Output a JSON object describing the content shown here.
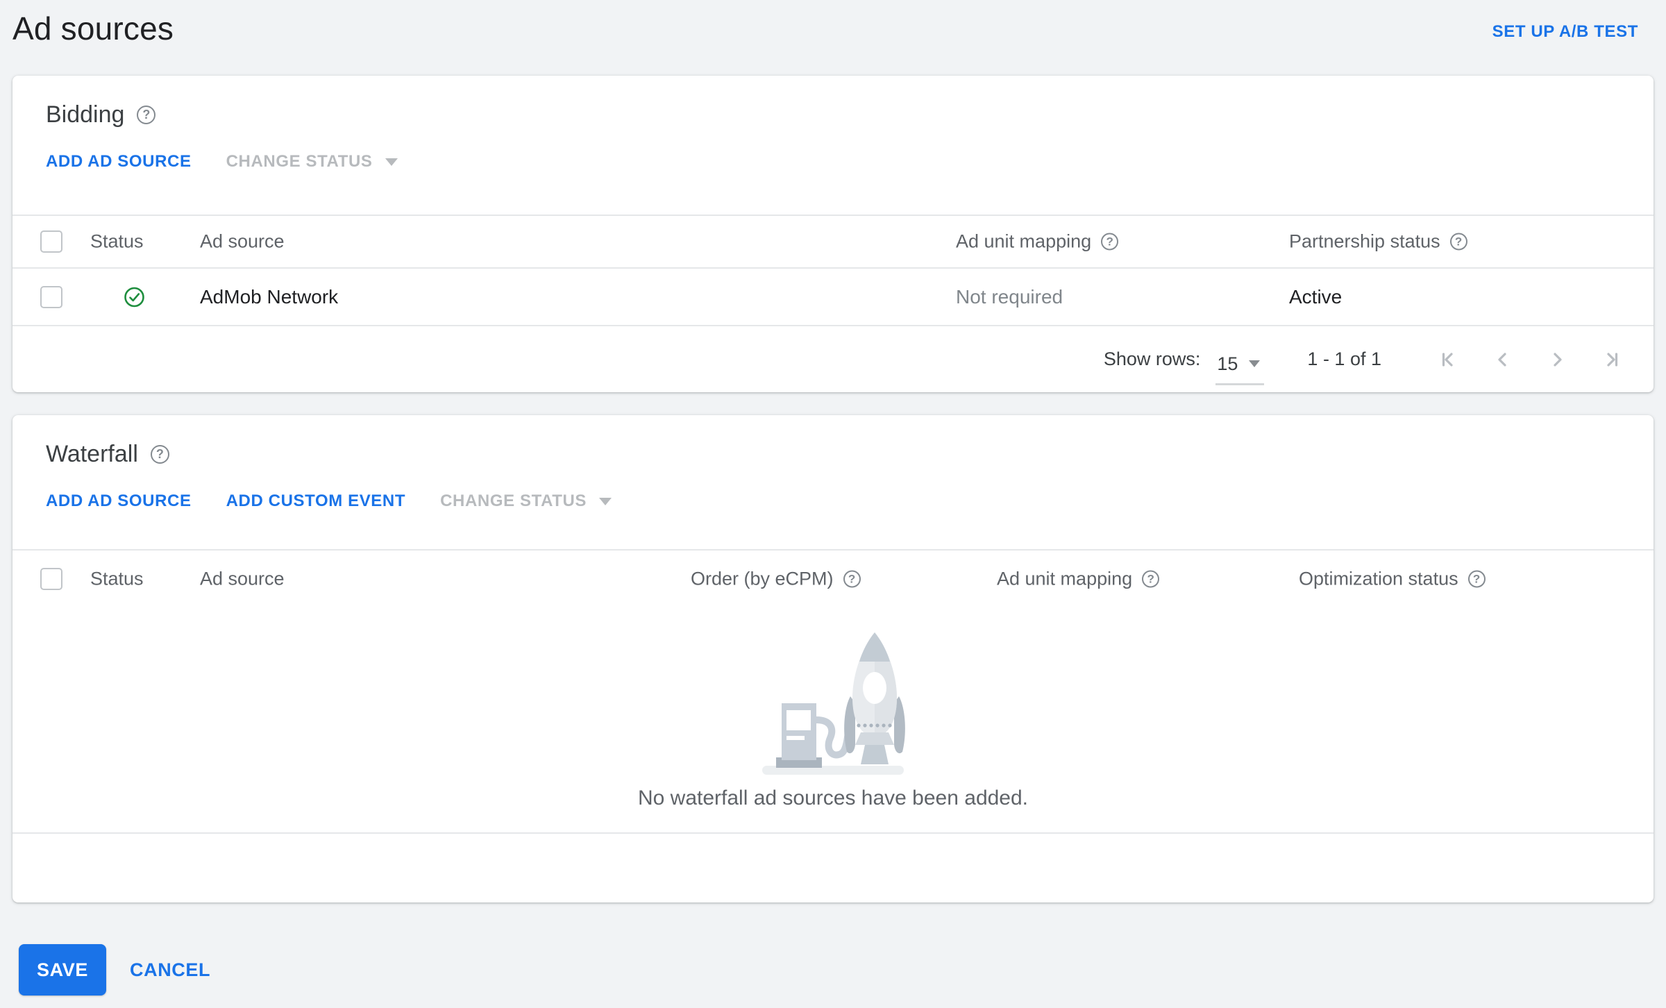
{
  "page": {
    "title": "Ad sources",
    "setup_ab_test": "SET UP A/B TEST"
  },
  "bidding": {
    "title": "Bidding",
    "actions": {
      "add_ad_source": "ADD AD SOURCE",
      "change_status": "CHANGE STATUS"
    },
    "table": {
      "headers": {
        "status": "Status",
        "ad_source": "Ad source",
        "ad_unit_mapping": "Ad unit mapping",
        "partnership_status": "Partnership status"
      },
      "rows": [
        {
          "status": "active",
          "ad_source": "AdMob Network",
          "ad_unit_mapping": "Not required",
          "partnership_status": "Active"
        }
      ]
    },
    "pagination": {
      "show_rows_label": "Show rows:",
      "show_rows_value": "15",
      "range": "1 - 1 of 1"
    }
  },
  "waterfall": {
    "title": "Waterfall",
    "actions": {
      "add_ad_source": "ADD AD SOURCE",
      "add_custom_event": "ADD CUSTOM EVENT",
      "change_status": "CHANGE STATUS"
    },
    "table": {
      "headers": {
        "status": "Status",
        "ad_source": "Ad source",
        "order": "Order (by eCPM)",
        "ad_unit_mapping": "Ad unit mapping",
        "optimization_status": "Optimization status"
      }
    },
    "empty_message": "No waterfall ad sources have been added."
  },
  "footer": {
    "save": "SAVE",
    "cancel": "CANCEL"
  },
  "colors": {
    "accent": "#1a73e8",
    "success_green": "#1e8e3e",
    "disabled_gray": "#b7babd",
    "muted_text": "#5f6368"
  }
}
